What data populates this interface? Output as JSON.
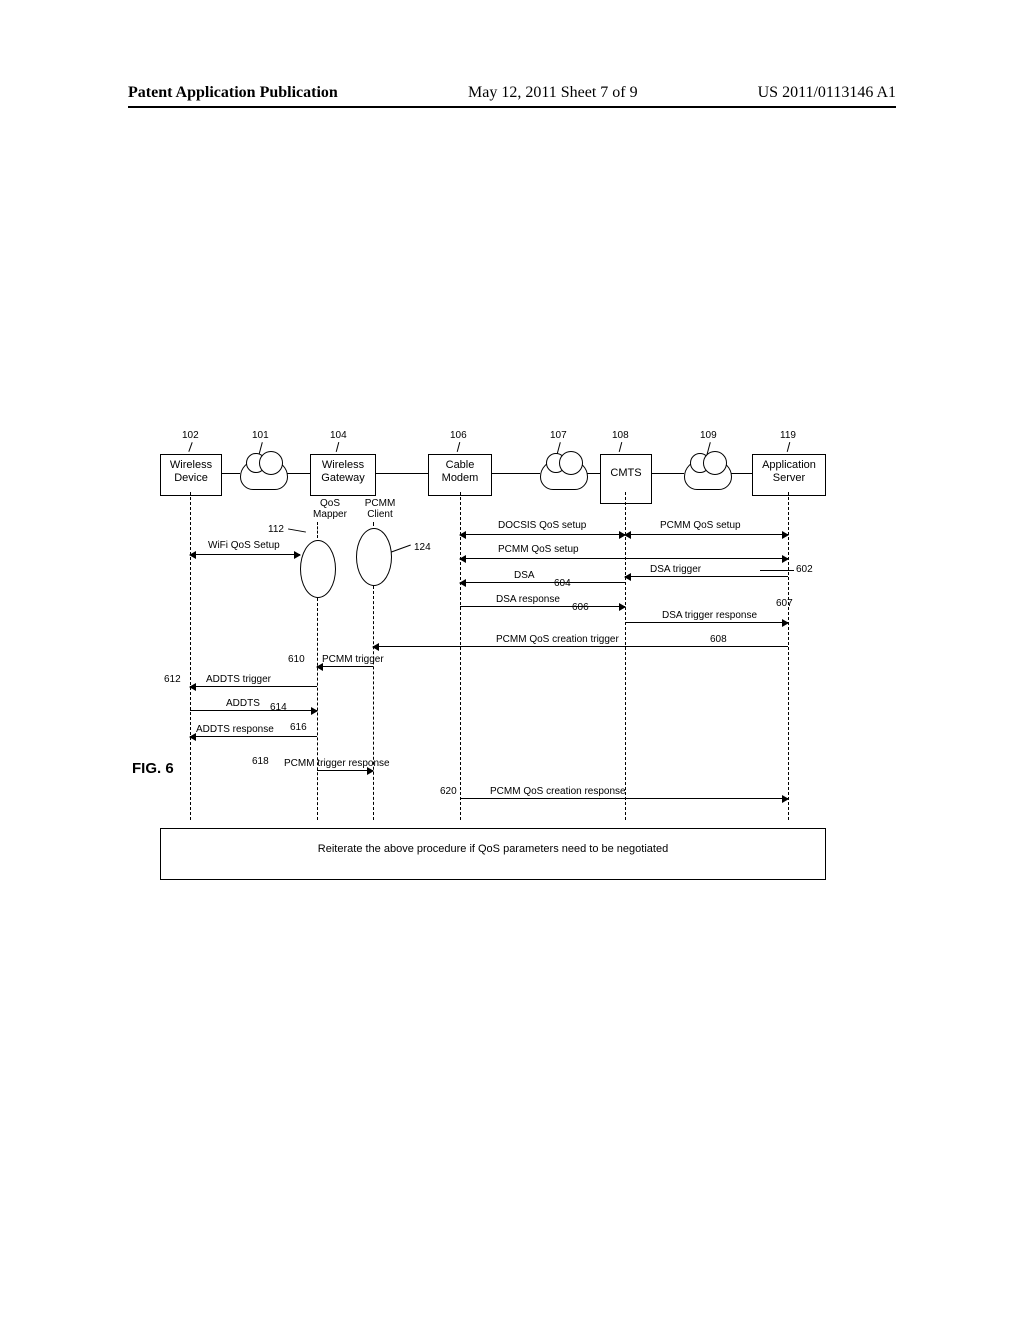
{
  "header": {
    "left": "Patent Application Publication",
    "mid": "May 12, 2011  Sheet 7 of 9",
    "right": "US 2011/0113146 A1"
  },
  "figure_label": "FIG. 6",
  "entities": {
    "e102": {
      "ref": "102",
      "label_l1": "Wireless",
      "label_l2": "Device"
    },
    "e101": {
      "ref": "101"
    },
    "e104": {
      "ref": "104",
      "label_l1": "Wireless",
      "label_l2": "Gateway"
    },
    "e106": {
      "ref": "106",
      "label_l1": "Cable",
      "label_l2": "Modem"
    },
    "e107": {
      "ref": "107"
    },
    "e108": {
      "ref": "108",
      "label_l1": "CMTS",
      "label_l2": ""
    },
    "e109": {
      "ref": "109"
    },
    "e119": {
      "ref": "119",
      "label_l1": "Application",
      "label_l2": "Server"
    }
  },
  "subcomponents": {
    "s112": {
      "ref": "112",
      "label_l1": "QoS",
      "label_l2": "Mapper"
    },
    "s124": {
      "ref": "124",
      "label_l1": "PCMM",
      "label_l2": "Client"
    }
  },
  "setup_labels": {
    "wifi": "WiFi QoS Setup",
    "docsis": "DOCSIS QoS setup",
    "pcmm": "PCMM QoS setup",
    "pcmm2": "PCMM QoS setup"
  },
  "messages": {
    "m602": {
      "ref": "602",
      "text": "DSA trigger"
    },
    "m604": {
      "ref": "604",
      "text": "DSA"
    },
    "m606": {
      "ref": "606",
      "text": "DSA response"
    },
    "m607": {
      "ref": "607",
      "text": "DSA trigger response"
    },
    "m608": {
      "ref": "608",
      "text": "PCMM QoS creation trigger"
    },
    "m610": {
      "ref": "610",
      "text": "PCMM trigger"
    },
    "m612": {
      "ref": "612",
      "text": "ADDTS trigger"
    },
    "m614": {
      "ref": "614",
      "text": "ADDTS"
    },
    "m616": {
      "ref": "616",
      "text": "ADDTS response"
    },
    "m618": {
      "ref": "618",
      "text": "PCMM trigger response"
    },
    "m620": {
      "ref": "620",
      "text": "PCMM QoS creation response"
    }
  },
  "note": "Reiterate the above procedure if QoS parameters need to be negotiated",
  "chart_data": {
    "type": "sequence-diagram",
    "participants": [
      {
        "id": "WirelessDevice",
        "label": "Wireless Device",
        "ref": "102"
      },
      {
        "id": "Cloud101",
        "label": "(network cloud)",
        "ref": "101"
      },
      {
        "id": "WirelessGateway",
        "label": "Wireless Gateway",
        "ref": "104",
        "subcomponents": [
          {
            "id": "QoSMapper",
            "label": "QoS Mapper",
            "ref": "112"
          },
          {
            "id": "PCMMClient",
            "label": "PCMM Client",
            "ref": "124"
          }
        ]
      },
      {
        "id": "CableModem",
        "label": "Cable Modem",
        "ref": "106"
      },
      {
        "id": "Cloud107",
        "label": "(network cloud)",
        "ref": "107"
      },
      {
        "id": "CMTS",
        "label": "CMTS",
        "ref": "108"
      },
      {
        "id": "Cloud109",
        "label": "(network cloud)",
        "ref": "109"
      },
      {
        "id": "ApplicationServer",
        "label": "Application Server",
        "ref": "119"
      }
    ],
    "spans": [
      {
        "label": "WiFi QoS Setup",
        "from": "WirelessDevice",
        "to": "WirelessGateway"
      },
      {
        "label": "DOCSIS QoS setup",
        "from": "CableModem",
        "to": "CMTS"
      },
      {
        "label": "PCMM QoS setup",
        "from": "CMTS",
        "to": "ApplicationServer"
      },
      {
        "label": "PCMM QoS setup",
        "from": "CableModem",
        "to": "ApplicationServer"
      }
    ],
    "messages": [
      {
        "ref": "602",
        "text": "DSA trigger",
        "from": "ApplicationServer",
        "to": "CMTS"
      },
      {
        "ref": "604",
        "text": "DSA",
        "from": "CMTS",
        "to": "CableModem"
      },
      {
        "ref": "606",
        "text": "DSA response",
        "from": "CableModem",
        "to": "CMTS"
      },
      {
        "ref": "607",
        "text": "DSA trigger response",
        "from": "CMTS",
        "to": "ApplicationServer"
      },
      {
        "ref": "608",
        "text": "PCMM QoS creation trigger",
        "from": "ApplicationServer",
        "to": "PCMMClient"
      },
      {
        "ref": "610",
        "text": "PCMM trigger",
        "from": "PCMMClient",
        "to": "QoSMapper"
      },
      {
        "ref": "612",
        "text": "ADDTS trigger",
        "from": "QoSMapper",
        "to": "WirelessDevice"
      },
      {
        "ref": "614",
        "text": "ADDTS",
        "from": "WirelessDevice",
        "to": "WirelessGateway"
      },
      {
        "ref": "616",
        "text": "ADDTS response",
        "from": "WirelessGateway",
        "to": "WirelessDevice"
      },
      {
        "ref": "618",
        "text": "PCMM trigger response",
        "from": "QoSMapper",
        "to": "PCMMClient"
      },
      {
        "ref": "620",
        "text": "PCMM QoS creation response",
        "from": "CableModem",
        "to": "ApplicationServer"
      }
    ],
    "note": "Reiterate the above procedure if QoS parameters need to be negotiated"
  }
}
